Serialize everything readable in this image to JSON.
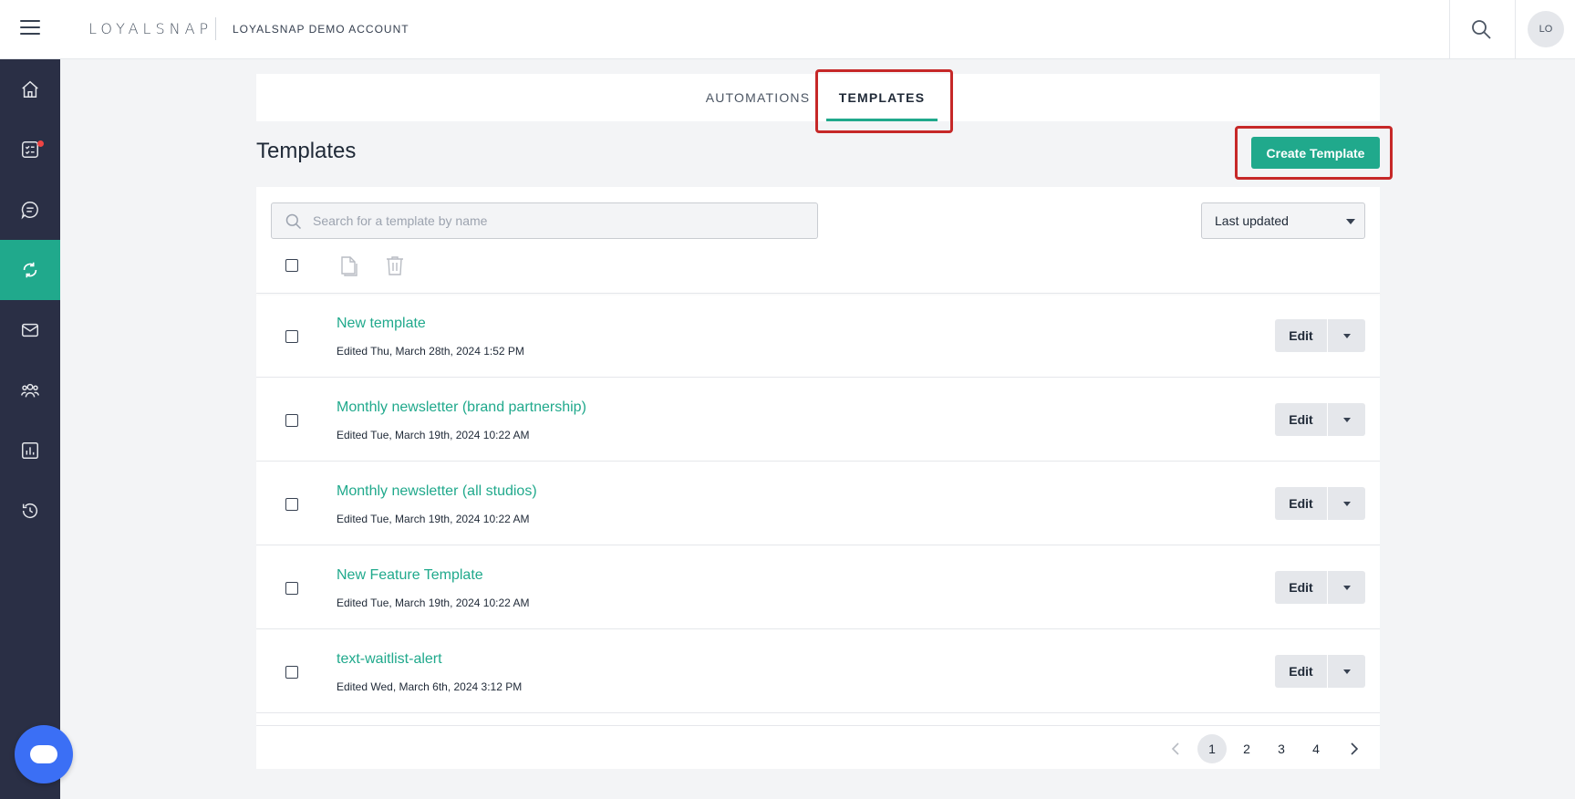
{
  "header": {
    "brand": "LOYALSNAP",
    "account": "LOYALSNAP DEMO ACCOUNT",
    "avatar_initials": "LO"
  },
  "sidebar": {
    "items": [
      {
        "icon": "home-icon"
      },
      {
        "icon": "checklist-icon",
        "has_notification": true
      },
      {
        "icon": "chat-icon"
      },
      {
        "icon": "sync-icon",
        "active": true
      },
      {
        "icon": "mail-icon"
      },
      {
        "icon": "people-icon"
      },
      {
        "icon": "bar-chart-icon"
      },
      {
        "icon": "history-icon"
      }
    ]
  },
  "tabs": {
    "automations": "AUTOMATIONS",
    "templates": "TEMPLATES",
    "active": "templates"
  },
  "page": {
    "title": "Templates",
    "create_label": "Create Template"
  },
  "search": {
    "placeholder": "Search for a template by name",
    "value": ""
  },
  "sort": {
    "selected": "Last updated"
  },
  "templates": [
    {
      "name": "New template",
      "edited": "Edited Thu, March 28th, 2024 1:52 PM"
    },
    {
      "name": "Monthly newsletter (brand partnership)",
      "edited": "Edited Tue, March 19th, 2024 10:22 AM"
    },
    {
      "name": "Monthly newsletter (all studios)",
      "edited": "Edited Tue, March 19th, 2024 10:22 AM"
    },
    {
      "name": "New Feature Template",
      "edited": "Edited Tue, March 19th, 2024 10:22 AM"
    },
    {
      "name": "text-waitlist-alert",
      "edited": "Edited Wed, March 6th, 2024 3:12 PM"
    }
  ],
  "row_actions": {
    "edit_label": "Edit"
  },
  "pagination": {
    "pages": [
      "1",
      "2",
      "3",
      "4"
    ],
    "current": "1"
  },
  "colors": {
    "accent": "#20a98c",
    "sidebar": "#2a2f45",
    "highlight": "#c62828",
    "chat_fab": "#3b6ff5"
  }
}
